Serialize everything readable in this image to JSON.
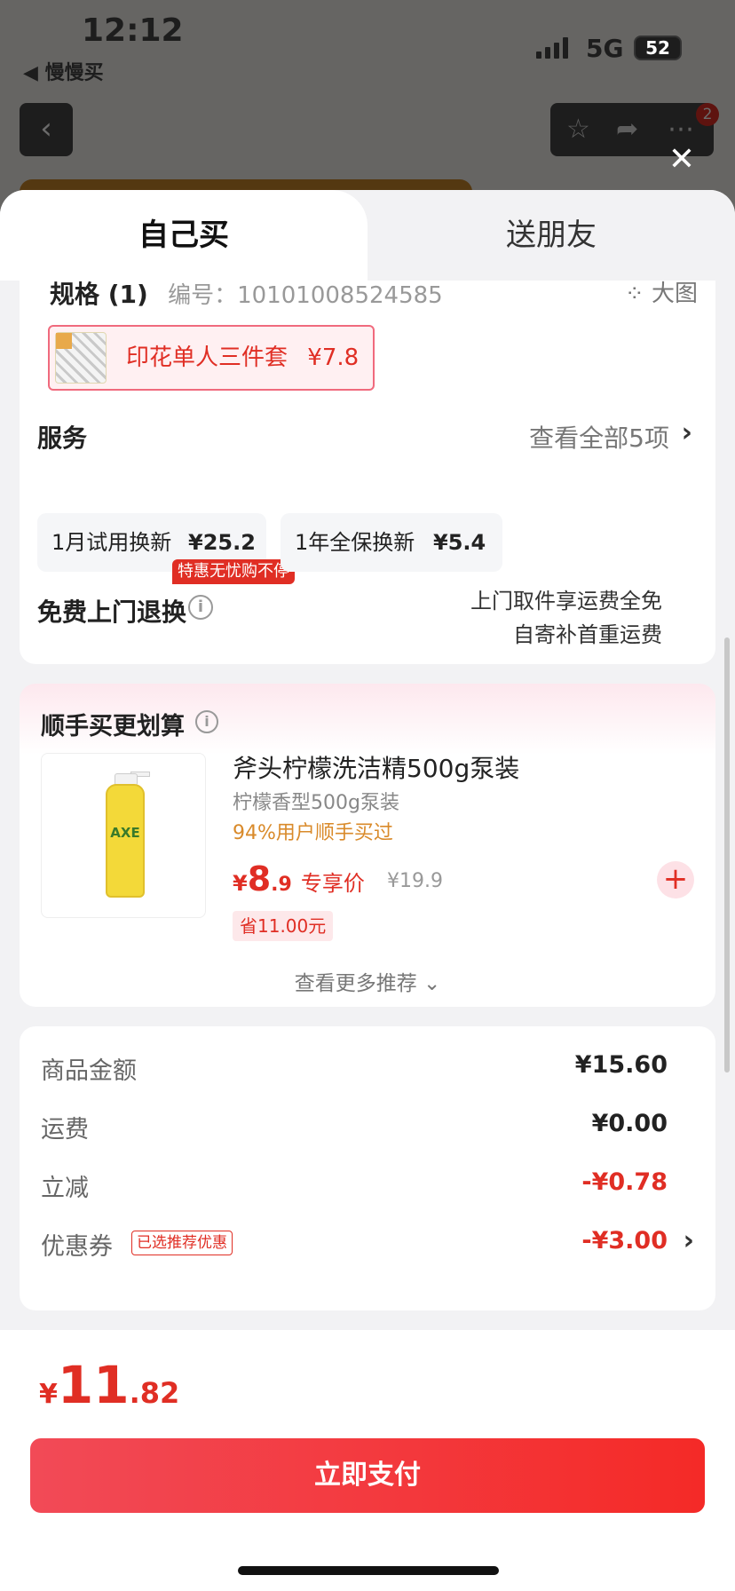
{
  "status_bar": {
    "time": "12:12",
    "back_app": "◀ 慢慢买",
    "network": "5G",
    "battery": "52"
  },
  "background_nav": {
    "badge_count": "2"
  },
  "tabs": [
    {
      "label": "自己买",
      "active": true
    },
    {
      "label": "送朋友",
      "active": false
    }
  ],
  "spec": {
    "title": "规格 (1)",
    "code_label": "编号：",
    "code_value": "10101008524585",
    "big_image": "大图",
    "selected_option": "印花单人三件套",
    "selected_price": "¥7.8"
  },
  "service": {
    "title": "服务",
    "view_all": "查看全部5项",
    "options": [
      {
        "name": "1月试用换新",
        "price": "¥25.2",
        "badge": "特惠无忧购不停"
      },
      {
        "name": "1年全保换新",
        "price": "¥5.4"
      }
    ]
  },
  "free_return": {
    "title": "免费上门退换",
    "line1": "上门取件享运费全免",
    "line2": "自寄补首重运费"
  },
  "recommend": {
    "title": "顺手买更划算",
    "product": {
      "name": "斧头柠檬洗洁精500g泵装",
      "spec": "柠檬香型500g泵装",
      "bought": "94%用户顺手买过",
      "price_currency": "¥",
      "price_int": "8",
      "price_dec": ".9",
      "price_tag": "专享价",
      "orig_price": "¥19.9",
      "save": "省11.00元",
      "brand_logo": "AXE"
    },
    "more": "查看更多推荐"
  },
  "summary": {
    "rows": [
      {
        "label": "商品金额",
        "value": "¥15.60"
      },
      {
        "label": "运费",
        "value": "¥0.00"
      },
      {
        "label": "立减",
        "value": "-¥0.78"
      },
      {
        "label": "优惠券",
        "value": "-¥3.00",
        "tag": "已选推荐优惠"
      }
    ]
  },
  "footer": {
    "total_currency": "¥",
    "total_int": "11",
    "total_dec": ".82",
    "pay_label": "立即支付"
  },
  "colors": {
    "accent": "#e02e24",
    "pay_start": "#f24a57",
    "pay_end": "#f42a27",
    "bought": "#d98a2a"
  }
}
